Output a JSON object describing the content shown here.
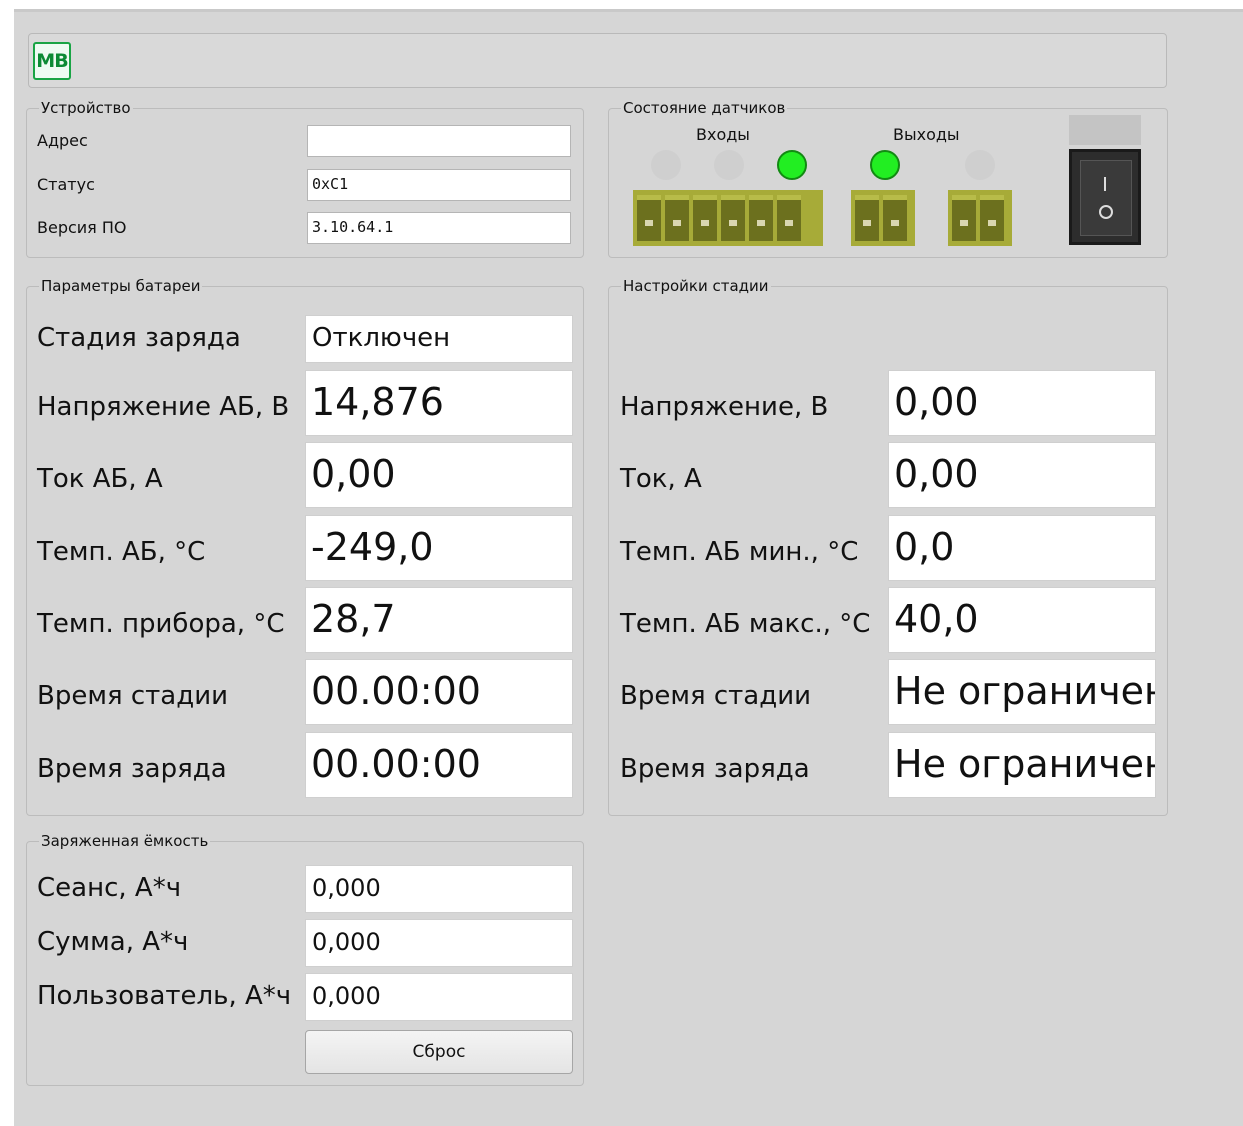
{
  "toolbar": {
    "logo_text": "MB"
  },
  "device": {
    "title": "Устройство",
    "rows": [
      {
        "label": "Адрес",
        "value": ""
      },
      {
        "label": "Статус",
        "value": "0xC1"
      },
      {
        "label": "Версия ПО",
        "value": "3.10.64.1"
      }
    ]
  },
  "sensors": {
    "title": "Состояние датчиков",
    "inputs_label": "Входы",
    "outputs_label": "Выходы",
    "input_leds": [
      false,
      false,
      true
    ],
    "output_leds": [
      true,
      false
    ],
    "switch_state": "off",
    "colors": {
      "led_on": "#22ee22",
      "led_off": "#cfcfcf",
      "connector": "#a7ab38"
    }
  },
  "battery": {
    "title": "Параметры батареи",
    "stage_label": "Стадия заряда",
    "stage_value": "Отключен",
    "rows": [
      {
        "label": "Напряжение АБ, В",
        "value": "14,876"
      },
      {
        "label": "Ток АБ, А",
        "value": "0,00"
      },
      {
        "label": "Темп. АБ, °C",
        "value": "-249,0"
      },
      {
        "label": "Темп. прибора, °C",
        "value": "28,7"
      },
      {
        "label": "Время стадии",
        "value": "00.00:00"
      },
      {
        "label": "Время заряда",
        "value": "00.00:00"
      }
    ]
  },
  "stage_settings": {
    "title": "Настройки стадии",
    "rows": [
      {
        "label": "Напряжение, В",
        "value": "0,00"
      },
      {
        "label": "Ток, А",
        "value": "0,00"
      },
      {
        "label": "Темп. АБ мин., °C",
        "value": "0,0"
      },
      {
        "label": "Темп. АБ макс., °C",
        "value": "40,0"
      },
      {
        "label": "Время стадии",
        "value": "Не ограничен"
      },
      {
        "label": "Время заряда",
        "value": "Не ограничен"
      }
    ]
  },
  "capacity": {
    "title": "Заряженная ёмкость",
    "rows": [
      {
        "label": "Сеанс, А*ч",
        "value": "0,000"
      },
      {
        "label": "Сумма, А*ч",
        "value": "0,000"
      },
      {
        "label": "Пользователь, А*ч",
        "value": "0,000"
      }
    ],
    "reset_label": "Сброс"
  }
}
